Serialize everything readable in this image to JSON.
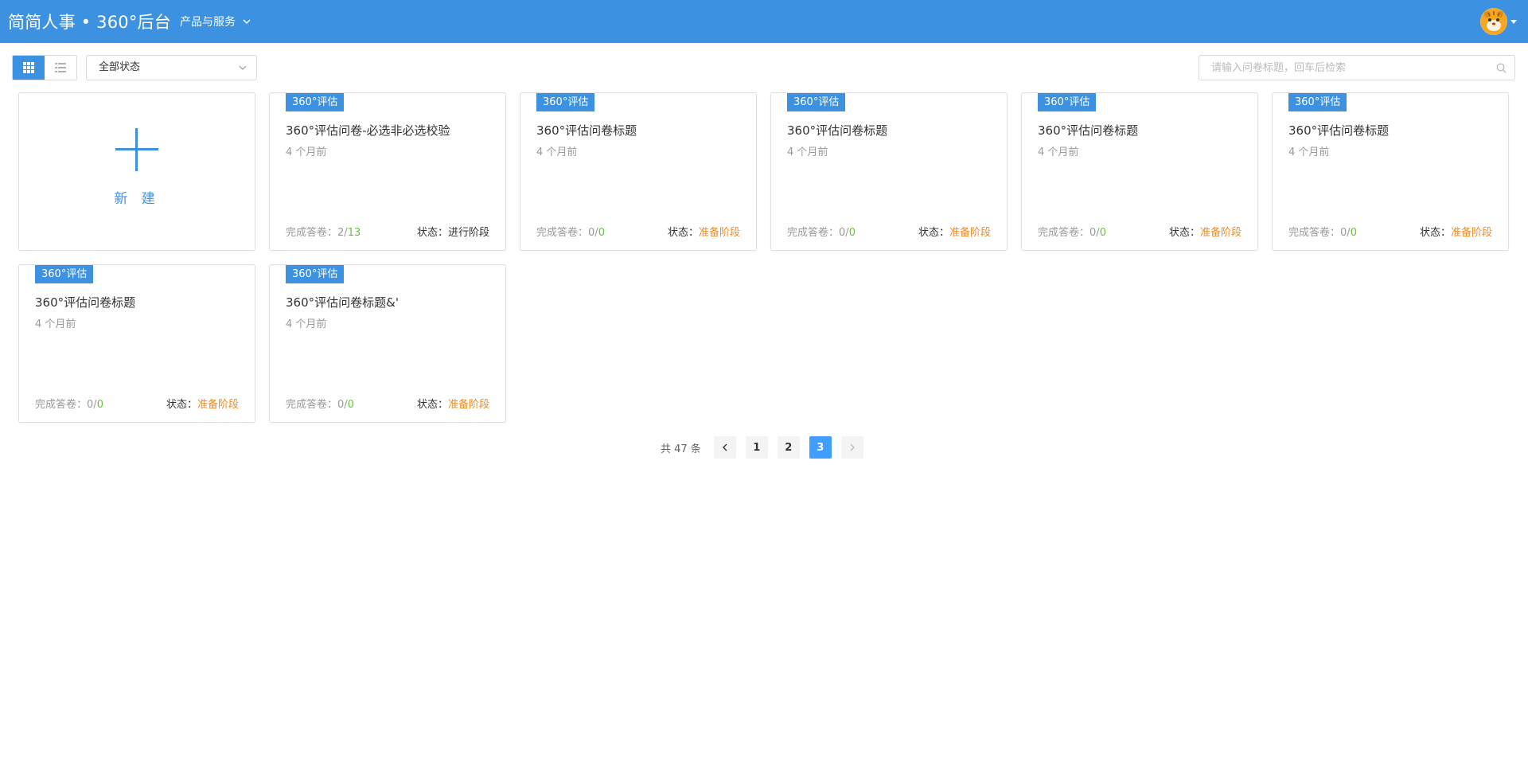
{
  "header": {
    "brand": "简简人事 • 360°后台",
    "nav_menu_label": "产品与服务"
  },
  "toolbar": {
    "status_select_value": "全部状态",
    "search_placeholder": "请输入问卷标题，回车后检索"
  },
  "new_card": {
    "label": "新 建"
  },
  "card_labels": {
    "done_prefix": "完成答卷：",
    "status_prefix": "状态："
  },
  "cards": [
    {
      "tag": "360°评估",
      "title": "360°评估问卷-必选非必选校验",
      "time": "4 个月前",
      "done": "2",
      "total": "13",
      "status": "进行阶段",
      "status_color": "#333333"
    },
    {
      "tag": "360°评估",
      "title": "360°评估问卷标题",
      "time": "4 个月前",
      "done": "0",
      "total": "0",
      "status": "准备阶段",
      "status_color": "#f08a24"
    },
    {
      "tag": "360°评估",
      "title": "360°评估问卷标题",
      "time": "4 个月前",
      "done": "0",
      "total": "0",
      "status": "准备阶段",
      "status_color": "#f08a24"
    },
    {
      "tag": "360°评估",
      "title": "360°评估问卷标题",
      "time": "4 个月前",
      "done": "0",
      "total": "0",
      "status": "准备阶段",
      "status_color": "#f08a24"
    },
    {
      "tag": "360°评估",
      "title": "360°评估问卷标题",
      "time": "4 个月前",
      "done": "0",
      "total": "0",
      "status": "准备阶段",
      "status_color": "#f08a24"
    },
    {
      "tag": "360°评估",
      "title": "360°评估问卷标题",
      "time": "4 个月前",
      "done": "0",
      "total": "0",
      "status": "准备阶段",
      "status_color": "#f08a24"
    },
    {
      "tag": "360°评估",
      "title": "360°评估问卷标题&'",
      "time": "4 个月前",
      "done": "0",
      "total": "0",
      "status": "准备阶段",
      "status_color": "#f08a24"
    }
  ],
  "pagination": {
    "total_text": "共 47 条",
    "pages": [
      "1",
      "2",
      "3"
    ],
    "current": "3"
  },
  "colors": {
    "header_bg": "#3d91e1",
    "accent": "#409eff",
    "orange": "#f08a24",
    "green": "#67c23a"
  },
  "icons": {
    "grid_view": "grid-icon",
    "list_view": "list-icon",
    "search": "search-icon",
    "chevron": "chevron-down-icon",
    "avatar": "tiger-avatar"
  }
}
